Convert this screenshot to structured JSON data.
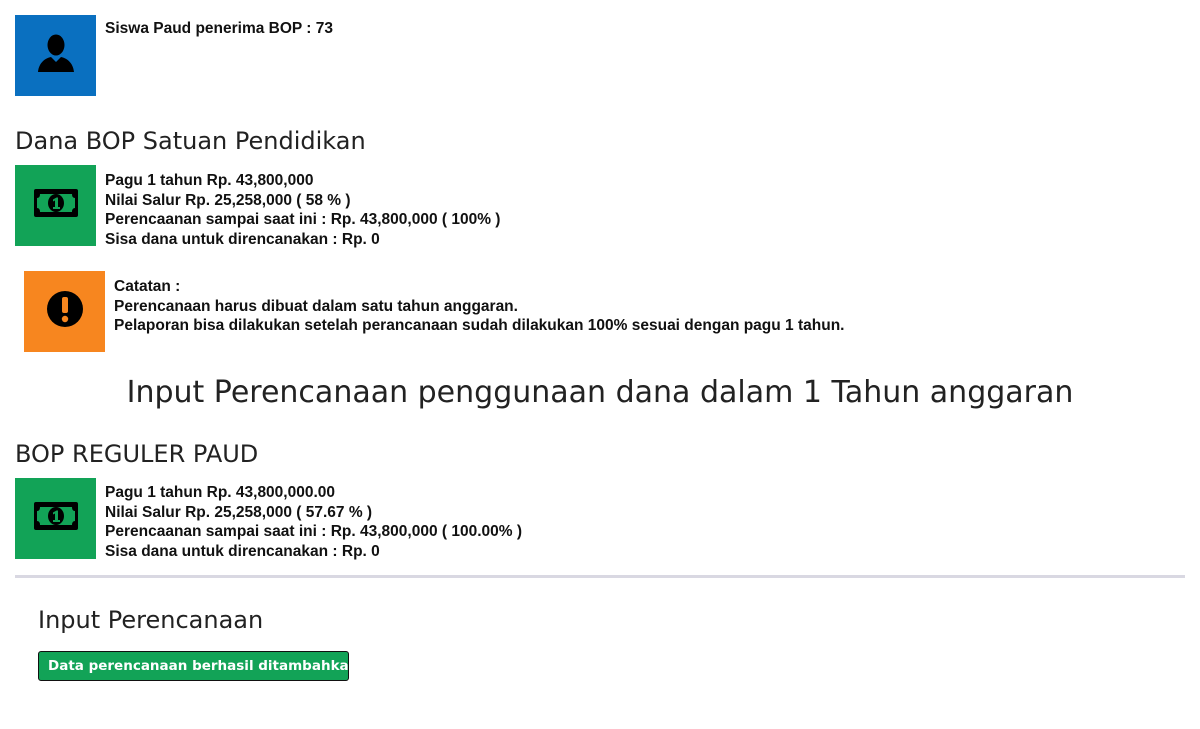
{
  "colors": {
    "blue_tile": "#0a70c0",
    "green_tile": "#12a357",
    "orange_tile": "#f7861f",
    "alert_bg": "#12a357",
    "divider": "#d9d8e2"
  },
  "icons": {
    "student": "user-icon",
    "money": "money-bill-icon",
    "warning": "exclamation-circle-icon"
  },
  "student_card": {
    "text": "Siswa Paud penerima BOP : 73"
  },
  "dana_section": {
    "title": "Dana BOP Satuan Pendidikan",
    "lines": [
      "Pagu 1 tahun Rp. 43,800,000",
      "Nilai Salur Rp. 25,258,000 ( 58 % )",
      "Perencaanan sampai saat ini : Rp. 43,800,000 ( 100% )",
      "Sisa dana untuk direncanakan : Rp. 0"
    ]
  },
  "note": {
    "lines": [
      "Catatan :",
      "Perencanaan harus dibuat dalam satu tahun anggaran.",
      "Pelaporan bisa dilakukan setelah perancanaan sudah dilakukan 100% sesuai dengan pagu 1 tahun."
    ]
  },
  "main_title": "Input Perencanaan penggunaan dana dalam 1 Tahun anggaran",
  "reguler_section": {
    "title": "BOP REGULER PAUD",
    "lines": [
      "Pagu 1 tahun Rp. 43,800,000.00",
      "Nilai Salur Rp. 25,258,000 ( 57.67 % )",
      "Perencaanan sampai saat ini : Rp. 43,800,000 ( 100.00% )",
      "Sisa dana untuk direncanakan : Rp. 0"
    ]
  },
  "input_section": {
    "title": "Input Perencanaan",
    "alert": "Data perencanaan berhasil ditambahkan."
  }
}
